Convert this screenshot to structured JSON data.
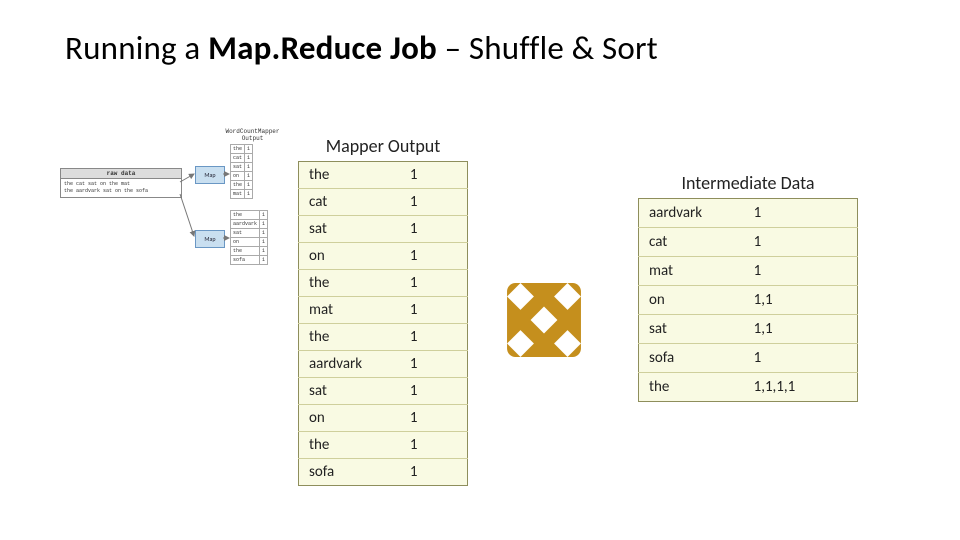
{
  "title": {
    "pre": "Running a ",
    "bold": "Map.Reduce Job ",
    "post": "– Shuffle & Sort"
  },
  "mini": {
    "raw_header": "raw data",
    "raw_text": "the cat sat on the mat\nthe aardvark sat on the sofa",
    "map_label": "Map",
    "out_header": "WordCountMapper\nOutput",
    "t1": [
      [
        "the",
        "1"
      ],
      [
        "cat",
        "1"
      ],
      [
        "sat",
        "1"
      ],
      [
        "on",
        "1"
      ],
      [
        "the",
        "1"
      ],
      [
        "mat",
        "1"
      ]
    ],
    "t2": [
      [
        "the",
        "1"
      ],
      [
        "aardvark",
        "1"
      ],
      [
        "sat",
        "1"
      ],
      [
        "on",
        "1"
      ],
      [
        "the",
        "1"
      ],
      [
        "sofa",
        "1"
      ]
    ]
  },
  "mapper": {
    "title": "Mapper Output",
    "rows": [
      [
        "the",
        "1"
      ],
      [
        "cat",
        "1"
      ],
      [
        "sat",
        "1"
      ],
      [
        "on",
        "1"
      ],
      [
        "the",
        "1"
      ],
      [
        "mat",
        "1"
      ],
      [
        "the",
        "1"
      ],
      [
        "aardvark",
        "1"
      ],
      [
        "sat",
        "1"
      ],
      [
        "on",
        "1"
      ],
      [
        "the",
        "1"
      ],
      [
        "sofa",
        "1"
      ]
    ]
  },
  "inter": {
    "title": "Intermediate Data",
    "rows": [
      [
        "aardvark",
        "1"
      ],
      [
        "cat",
        "1"
      ],
      [
        "mat",
        "1"
      ],
      [
        "on",
        "1,1"
      ],
      [
        "sat",
        "1,1"
      ],
      [
        "sofa",
        "1"
      ],
      [
        "the",
        "1,1,1,1"
      ]
    ]
  },
  "icon": {
    "name": "shuffle-sort"
  }
}
